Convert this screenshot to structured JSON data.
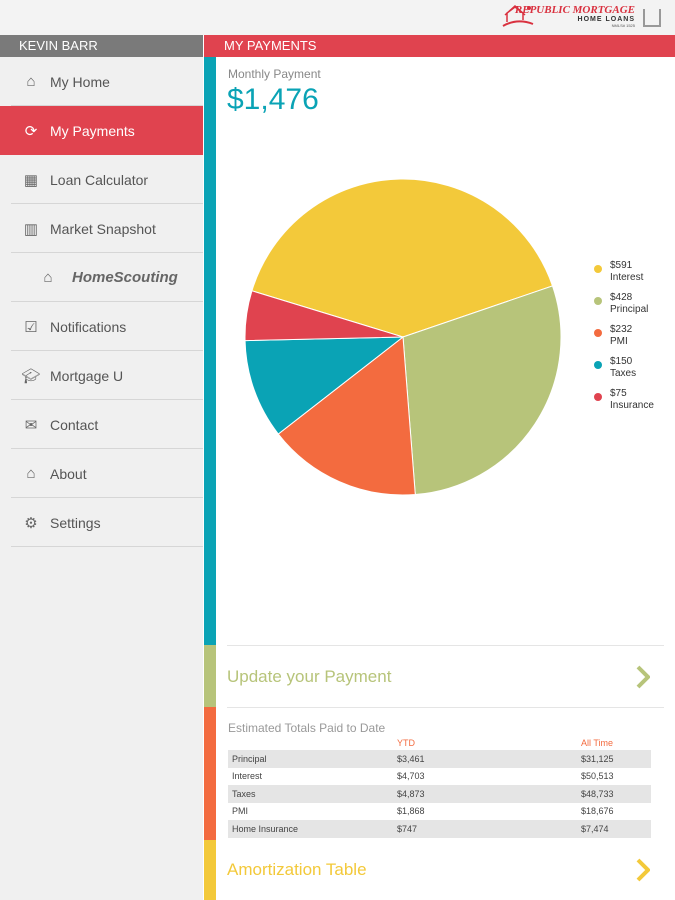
{
  "brand": {
    "name": "REPUBLIC MORTGAGE",
    "sub": "HOME LOANS",
    "tag": "NMLS# 1525"
  },
  "user": "KEVIN BARR",
  "page_title": "MY PAYMENTS",
  "sidebar": {
    "items": [
      {
        "label": "My Home",
        "icon": "home-icon"
      },
      {
        "label": "My Payments",
        "icon": "refresh-icon"
      },
      {
        "label": "Loan Calculator",
        "icon": "calculator-icon"
      },
      {
        "label": "Market Snapshot",
        "icon": "map-icon"
      },
      {
        "label": "HomeScouting",
        "icon": "homescouting-logo"
      },
      {
        "label": "Notifications",
        "icon": "checkbox-icon"
      },
      {
        "label": "Mortgage U",
        "icon": "graduation-cap-icon"
      },
      {
        "label": "Contact",
        "icon": "envelope-icon"
      },
      {
        "label": "About",
        "icon": "house-logo-icon"
      },
      {
        "label": "Settings",
        "icon": "gear-icon"
      }
    ]
  },
  "monthly": {
    "label": "Monthly Payment",
    "value": "$1,476"
  },
  "chart_data": {
    "type": "pie",
    "total": 1476,
    "slices": [
      {
        "name": "Interest",
        "label": "$591",
        "value": 591,
        "color": "#f3c93a"
      },
      {
        "name": "Principal",
        "label": "$428",
        "value": 428,
        "color": "#b7c47a"
      },
      {
        "name": "PMI",
        "label": "$232",
        "value": 232,
        "color": "#f36b3f"
      },
      {
        "name": "Taxes",
        "label": "$150",
        "value": 150,
        "color": "#0aa3b5"
      },
      {
        "name": "Insurance",
        "label": "$75",
        "value": 75,
        "color": "#e0434f"
      }
    ]
  },
  "update": "Update your Payment",
  "totals": {
    "title": "Estimated Totals Paid to Date",
    "headers": [
      "",
      "YTD",
      "All Time"
    ],
    "rows": [
      [
        "Principal",
        "$3,461",
        "$31,125"
      ],
      [
        "Interest",
        "$4,703",
        "$50,513"
      ],
      [
        "Taxes",
        "$4,873",
        "$48,733"
      ],
      [
        "PMI",
        "$1,868",
        "$18,676"
      ],
      [
        "Home Insurance",
        "$747",
        "$7,474"
      ]
    ]
  },
  "amortization": "Amortization Table",
  "colors": {
    "red": "#e0434f",
    "teal": "#0aa3b5",
    "green": "#b7c47a",
    "orange": "#f36b3f",
    "yellow": "#f3c93a"
  }
}
